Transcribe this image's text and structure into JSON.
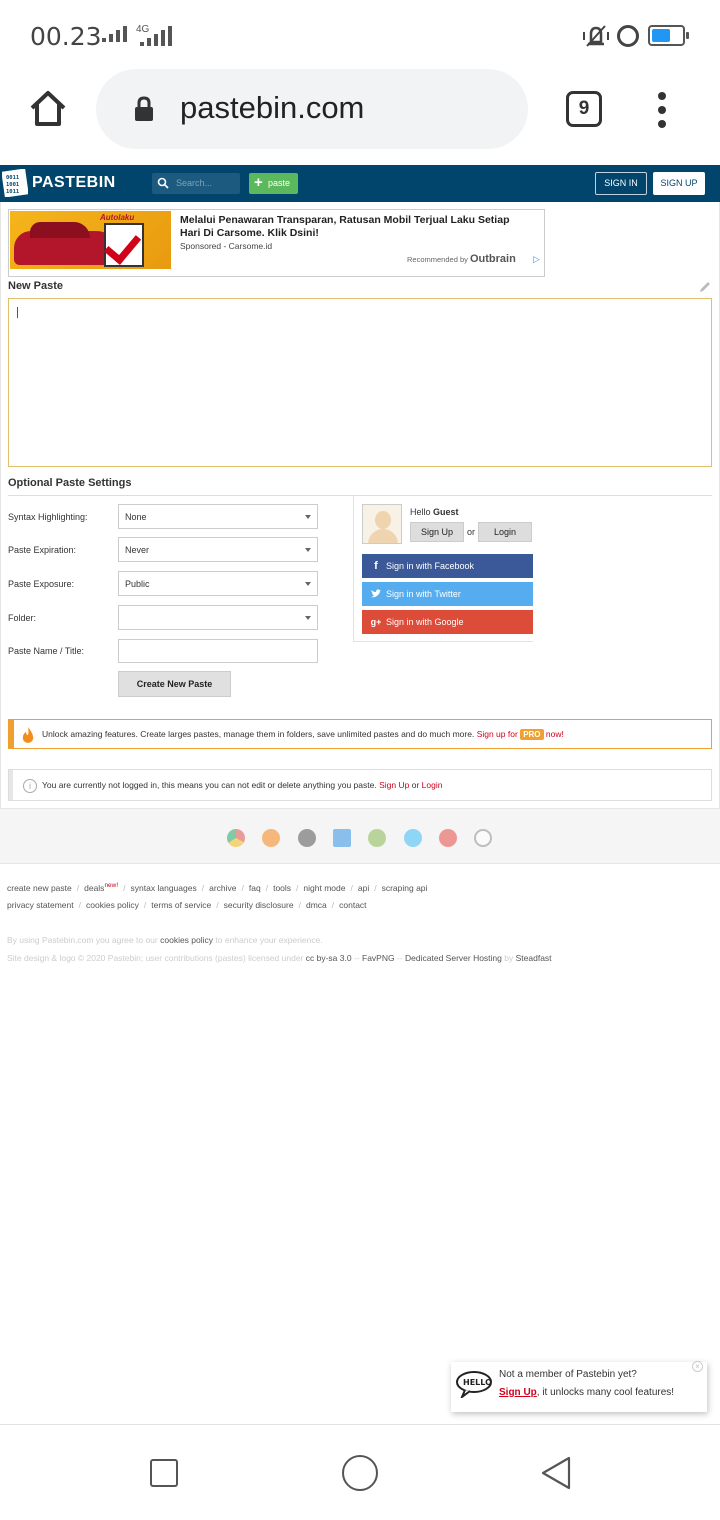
{
  "status_bar": {
    "time": "00.23",
    "network": "4G"
  },
  "browser": {
    "url": "pastebin.com",
    "tab_count": "9"
  },
  "header": {
    "brand": "PASTEBIN",
    "search_placeholder": "Search...",
    "paste_label": "paste",
    "sign_in": "SIGN IN",
    "sign_up": "SIGN UP"
  },
  "ad": {
    "brand": "Autolaku",
    "title": "Melalui Penawaran Transparan, Ratusan Mobil Terjual Laku Setiap Hari Di Carsome. Klik Dsini!",
    "sponsored": "Sponsored - Carsome.id",
    "recommended": "Recommended by",
    "outbrain": "Outbrain"
  },
  "paste": {
    "heading": "New Paste",
    "content": ""
  },
  "settings": {
    "heading": "Optional Paste Settings",
    "rows": [
      {
        "label": "Syntax Highlighting:",
        "value": "None"
      },
      {
        "label": "Paste Expiration:",
        "value": "Never"
      },
      {
        "label": "Paste Exposure:",
        "value": "Public"
      },
      {
        "label": "Folder:",
        "value": ""
      }
    ],
    "name_label": "Paste Name / Title:",
    "name_value": "",
    "create_button": "Create New Paste"
  },
  "guest": {
    "hello": "Hello",
    "name": "Guest",
    "sign_up": "Sign Up",
    "or": "or",
    "login": "Login",
    "facebook": "Sign in with Facebook",
    "twitter": "Sign in with Twitter",
    "google": "Sign in with Google"
  },
  "pro_banner": {
    "text": "Unlock amazing features. Create larges pastes, manage them in folders, save unlimited pastes and do much more.",
    "signup": "Sign up for",
    "badge": "PRO",
    "now": "now!"
  },
  "login_notice": {
    "text": "You are currently not logged in, this means you can not edit or delete anything you paste.",
    "signup": "Sign Up",
    "or": "or",
    "login": "Login"
  },
  "footer": {
    "row1": [
      "create new paste",
      "deals",
      "syntax languages",
      "archive",
      "faq",
      "tools",
      "night mode",
      "api",
      "scraping api"
    ],
    "deals_badge": "new!",
    "row2": [
      "privacy statement",
      "cookies policy",
      "terms of service",
      "security disclosure",
      "dmca",
      "contact"
    ],
    "agree_pre": "By using Pastebin.com you agree to our",
    "agree_link": "cookies policy",
    "agree_post": "to enhance your experience.",
    "copy_pre": "Site design & logo © 2020 Pastebin; user contributions (pastes) licensed under",
    "cc": "cc by-sa 3.0",
    "dash1": "--",
    "favpng": "FavPNG",
    "dash2": "--",
    "hosting": "Dedicated Server Hosting",
    "by": "by",
    "steadfast": "Steadfast"
  },
  "popup": {
    "line1": "Not a member of Pastebin yet?",
    "signup": "Sign Up",
    "line2_rest": ", it unlocks many cool features!"
  },
  "colors": {
    "header_bg": "#02456c",
    "paste_green": "#5cb85c",
    "facebook": "#3b5998",
    "twitter": "#55acee",
    "google": "#dd4b39",
    "pro_orange": "#f0a030",
    "link_red": "#d0021b"
  },
  "icons": [
    "home-icon",
    "lock-icon",
    "tabs-icon",
    "kebab-menu-icon",
    "search-icon",
    "pencil-icon",
    "facebook-icon",
    "twitter-icon",
    "google-plus-icon",
    "fire-icon",
    "info-icon",
    "hello-bubble-icon",
    "close-icon"
  ]
}
